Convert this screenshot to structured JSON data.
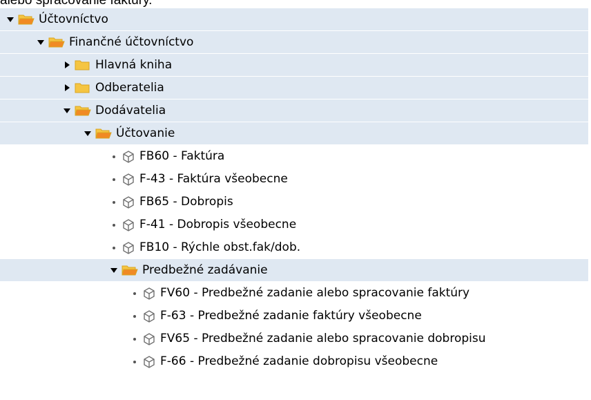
{
  "caption": "alebo spracovanie faktúry.",
  "tree": {
    "nodes": [
      {
        "label": "Účtovníctvo",
        "type": "folder",
        "state": "expanded"
      },
      {
        "label": "Finančné účtovníctvo",
        "type": "folder",
        "state": "expanded"
      },
      {
        "label": "Hlavná kniha",
        "type": "folder",
        "state": "collapsed"
      },
      {
        "label": "Odberatelia",
        "type": "folder",
        "state": "collapsed"
      },
      {
        "label": "Dodávatelia",
        "type": "folder",
        "state": "expanded"
      },
      {
        "label": "Účtovanie",
        "type": "folder",
        "state": "expanded"
      },
      {
        "label": "FB60 - Faktúra",
        "type": "transaction"
      },
      {
        "label": "F-43 - Faktúra všeobecne",
        "type": "transaction"
      },
      {
        "label": "FB65 - Dobropis",
        "type": "transaction"
      },
      {
        "label": "F-41 - Dobropis všeobecne",
        "type": "transaction"
      },
      {
        "label": "FB10 - Rýchle obst.fak/dob.",
        "type": "transaction"
      },
      {
        "label": "Predbežné zadávanie",
        "type": "folder",
        "state": "expanded"
      },
      {
        "label": "FV60 - Predbežné zadanie alebo spracovanie faktúry",
        "type": "transaction"
      },
      {
        "label": "F-63 - Predbežné zadanie faktúry všeobecne",
        "type": "transaction"
      },
      {
        "label": "FV65 - Predbežné zadanie alebo spracovanie dobropisu",
        "type": "transaction"
      },
      {
        "label": "F-66 - Predbežné zadanie dobropisu všeobecne",
        "type": "transaction"
      }
    ]
  },
  "icons": {
    "folder": "folder-icon",
    "folder_open": "folder-open-icon",
    "transaction": "cube-icon",
    "expanded": "triangle-down-icon",
    "collapsed": "triangle-right-icon"
  },
  "colors": {
    "folder_row_bg": "#dfe8f2",
    "folder_fill": "#f5c542",
    "folder_edge": "#d9a520",
    "open_folder_front": "#f08a24"
  }
}
